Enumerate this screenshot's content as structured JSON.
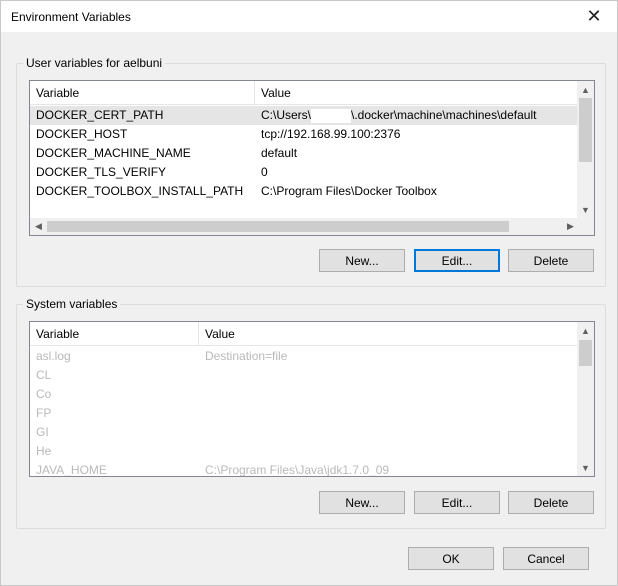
{
  "window": {
    "title": "Environment Variables",
    "close_glyph": "✕"
  },
  "user_section": {
    "label": "User variables for aelbuni",
    "columns": [
      "Variable",
      "Value"
    ],
    "rows": [
      {
        "variable": "DOCKER_CERT_PATH",
        "value_prefix": "C:\\Users\\",
        "value_suffix": "\\.docker\\machine\\machines\\default"
      },
      {
        "variable": "DOCKER_HOST",
        "value": "tcp://192.168.99.100:2376"
      },
      {
        "variable": "DOCKER_MACHINE_NAME",
        "value": "default"
      },
      {
        "variable": "DOCKER_TLS_VERIFY",
        "value": "0"
      },
      {
        "variable": "DOCKER_TOOLBOX_INSTALL_PATH",
        "value": "C:\\Program Files\\Docker Toolbox"
      }
    ],
    "buttons": {
      "new": "New...",
      "edit": "Edit...",
      "delete": "Delete"
    }
  },
  "system_section": {
    "label": "System variables",
    "columns": [
      "Variable",
      "Value"
    ],
    "rows": [
      {
        "variable": "asl.log",
        "value": "Destination=file"
      },
      {
        "variable": "CL",
        "value": ""
      },
      {
        "variable": "Co",
        "value": ""
      },
      {
        "variable": "FP",
        "value": ""
      },
      {
        "variable": "GI",
        "value": ""
      },
      {
        "variable": "He",
        "value": ""
      },
      {
        "variable": "JAVA_HOME",
        "value": "C:\\Program Files\\Java\\jdk1.7.0_09"
      }
    ],
    "buttons": {
      "new": "New...",
      "edit": "Edit...",
      "delete": "Delete"
    }
  },
  "footer": {
    "ok": "OK",
    "cancel": "Cancel"
  },
  "icons": {
    "scroll_up": "▲",
    "scroll_down": "▼",
    "scroll_left": "◀",
    "scroll_right": "▶"
  },
  "colors": {
    "focus": "#0078d7",
    "selection": "#e5e5e5"
  }
}
